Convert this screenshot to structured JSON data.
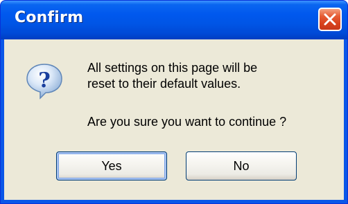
{
  "window": {
    "title": "Confirm",
    "close_label": "Close"
  },
  "dialog": {
    "icon": "question-icon",
    "message_lines": [
      "All settings on this page will be",
      "reset to their default values."
    ],
    "question": "Are you sure you want to continue ?"
  },
  "buttons": {
    "yes": "Yes",
    "no": "No"
  },
  "colors": {
    "titlebar": "#0058ee",
    "client_bg": "#ece9d8",
    "close_button": "#e65c34",
    "button_border": "#003c74"
  }
}
